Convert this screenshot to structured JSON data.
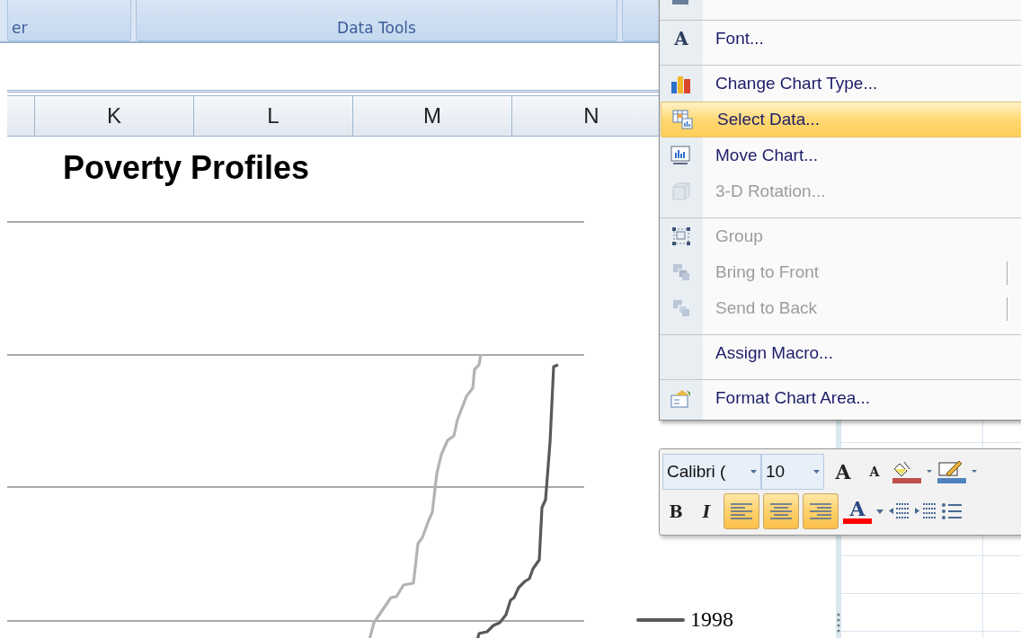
{
  "ribbon": {
    "groups": [
      {
        "label": "er"
      },
      {
        "label": "Data Tools"
      }
    ]
  },
  "column_headers": [
    "K",
    "L",
    "M",
    "N"
  ],
  "chart": {
    "title": "Poverty Profiles",
    "legend": [
      {
        "label": "1998",
        "color": "#595959"
      }
    ]
  },
  "context_menu": {
    "items": [
      {
        "label": "Font...",
        "icon_text": "A",
        "disabled": false,
        "selected": false,
        "separator_before": true,
        "submenu": false
      },
      {
        "label": "Change Chart Type...",
        "disabled": false,
        "selected": false,
        "separator_before": true,
        "submenu": false
      },
      {
        "label": "Select Data...",
        "disabled": false,
        "selected": true,
        "separator_before": false,
        "submenu": false
      },
      {
        "label": "Move Chart...",
        "disabled": false,
        "selected": false,
        "separator_before": false,
        "submenu": false
      },
      {
        "label": "3-D Rotation...",
        "disabled": true,
        "selected": false,
        "separator_before": false,
        "submenu": false
      },
      {
        "label": "Group",
        "disabled": true,
        "selected": false,
        "separator_before": true,
        "submenu": false
      },
      {
        "label": "Bring to Front",
        "disabled": true,
        "selected": false,
        "separator_before": false,
        "submenu": true
      },
      {
        "label": "Send to Back",
        "disabled": true,
        "selected": false,
        "separator_before": false,
        "submenu": true
      },
      {
        "label": "Assign Macro...",
        "disabled": false,
        "selected": false,
        "separator_before": true,
        "submenu": false
      },
      {
        "label": "Format Chart Area...",
        "disabled": false,
        "selected": false,
        "separator_before": true,
        "submenu": false
      }
    ]
  },
  "mini_toolbar": {
    "row_1": [
      {
        "kind": "font-field",
        "value": "Calibri ("
      },
      {
        "kind": "size-field",
        "value": "10"
      },
      {
        "kind": "grow",
        "glyph": "A"
      },
      {
        "kind": "shrink",
        "glyph": "A"
      },
      {
        "kind": "fill-color"
      },
      {
        "kind": "line-color"
      }
    ],
    "row_2": [
      {
        "kind": "bold",
        "glyph": "B",
        "selected": false
      },
      {
        "kind": "italic",
        "glyph": "I",
        "selected": false
      },
      {
        "kind": "align-left",
        "selected": true
      },
      {
        "kind": "align-center",
        "selected": true
      },
      {
        "kind": "align-right",
        "selected": true
      },
      {
        "kind": "font-color",
        "glyph": "A",
        "selected": false
      },
      {
        "kind": "outdent",
        "selected": false
      },
      {
        "kind": "indent",
        "selected": false
      },
      {
        "kind": "bullets",
        "selected": false
      }
    ]
  }
}
